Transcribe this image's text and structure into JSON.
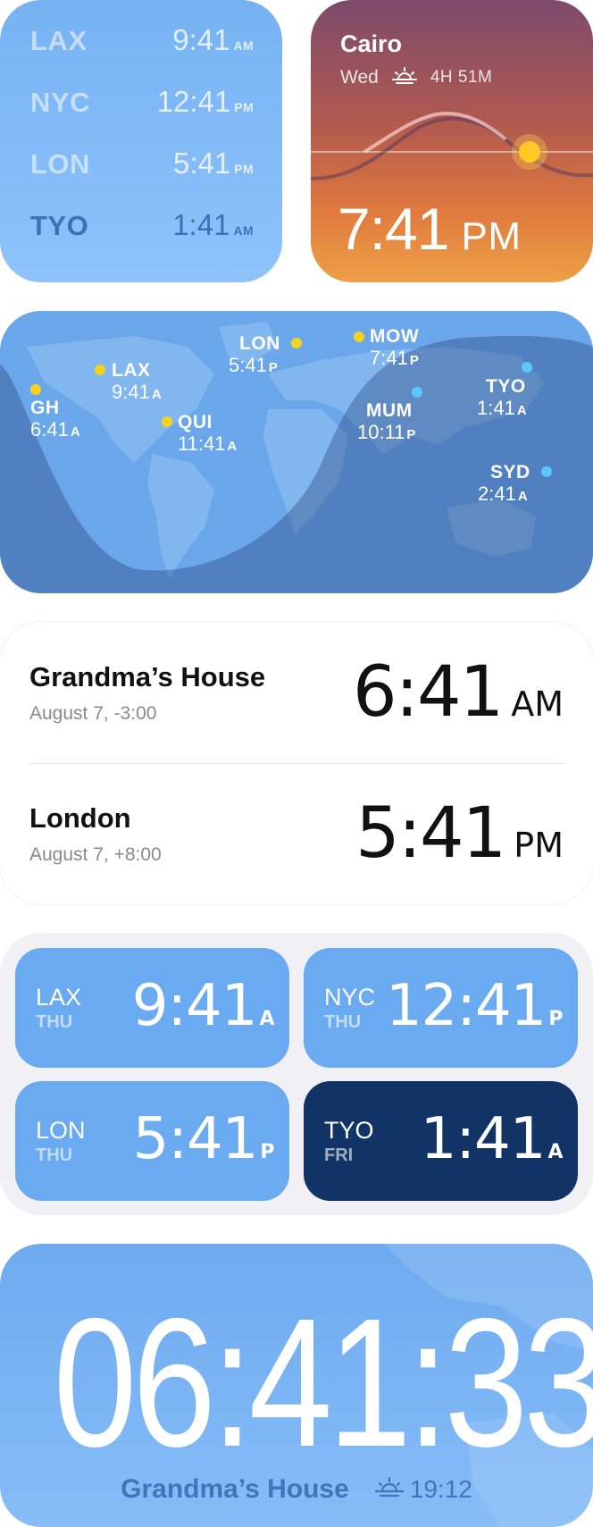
{
  "city_list": {
    "rows": [
      {
        "city": "LAX",
        "time": "9:41",
        "ampm": "AM"
      },
      {
        "city": "NYC",
        "time": "12:41",
        "ampm": "PM"
      },
      {
        "city": "LON",
        "time": "5:41",
        "ampm": "PM"
      },
      {
        "city": "TYO",
        "time": "1:41",
        "ampm": "AM"
      }
    ]
  },
  "cairo": {
    "city": "Cairo",
    "day": "Wed",
    "daylight": "4H 51M",
    "time": "7:41",
    "ampm": "PM",
    "icon": "sunset-icon"
  },
  "map": {
    "pins": [
      {
        "city": "GH",
        "time": "6:41",
        "ampm": "A"
      },
      {
        "city": "LAX",
        "time": "9:41",
        "ampm": "A"
      },
      {
        "city": "QUI",
        "time": "11:41",
        "ampm": "A"
      },
      {
        "city": "LON",
        "time": "5:41",
        "ampm": "P"
      },
      {
        "city": "MOW",
        "time": "7:41",
        "ampm": "P"
      },
      {
        "city": "MUM",
        "time": "10:11",
        "ampm": "P"
      },
      {
        "city": "TYO",
        "time": "1:41",
        "ampm": "A"
      },
      {
        "city": "SYD",
        "time": "2:41",
        "ampm": "A"
      }
    ]
  },
  "rows": [
    {
      "title": "Grandma’s House",
      "sub": "August 7, -3:00",
      "time": "6:41",
      "ampm": "AM"
    },
    {
      "title": "London",
      "sub": "August 7, +8:00",
      "time": "5:41",
      "ampm": "PM"
    }
  ],
  "grid": [
    {
      "code": "LAX",
      "day": "THU",
      "time": "9:41",
      "ampm": "A"
    },
    {
      "code": "NYC",
      "day": "THU",
      "time": "12:41",
      "ampm": "P"
    },
    {
      "code": "LON",
      "day": "THU",
      "time": "5:41",
      "ampm": "P"
    },
    {
      "code": "TYO",
      "day": "FRI",
      "time": "1:41",
      "ampm": "A"
    }
  ],
  "big": {
    "time": "06:41:33",
    "location": "Grandma’s House",
    "sunset": "19:12"
  },
  "colors": {
    "widget_blue": "#6aaaf0",
    "tile_dark": "#123366",
    "day_dot": "#f6d21e",
    "night_dot": "#5ec6ff"
  }
}
